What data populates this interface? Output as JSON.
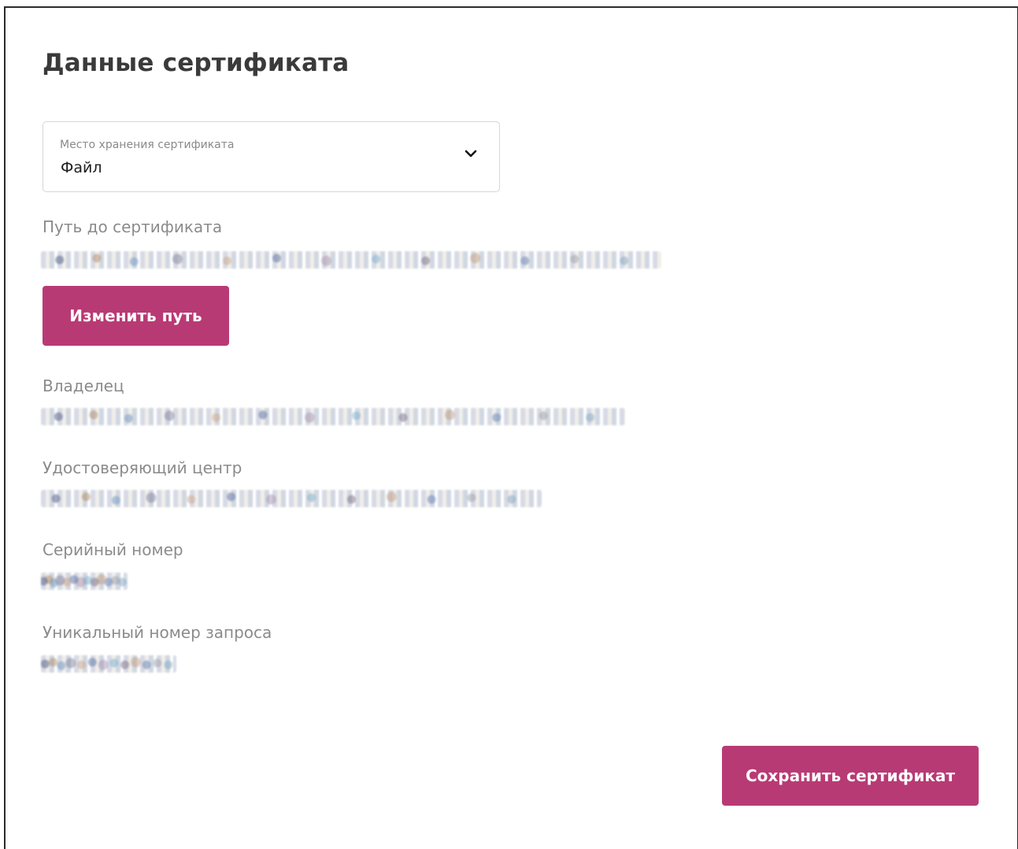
{
  "page": {
    "title": "Данные сертификата"
  },
  "storage_select": {
    "label": "Место хранения сертификата",
    "value": "Файл"
  },
  "fields": {
    "path": {
      "label": "Путь до сертификата"
    },
    "owner": {
      "label": "Владелец"
    },
    "issuer": {
      "label": "Удостоверяющий центр"
    },
    "serial": {
      "label": "Серийный номер"
    },
    "request_id": {
      "label": "Уникальный номер запроса"
    }
  },
  "buttons": {
    "change_path": "Изменить путь",
    "save": "Сохранить сертификат"
  },
  "colors": {
    "accent": "#b83a74",
    "label": "#8b8b8b",
    "title": "#3a3a3a"
  }
}
